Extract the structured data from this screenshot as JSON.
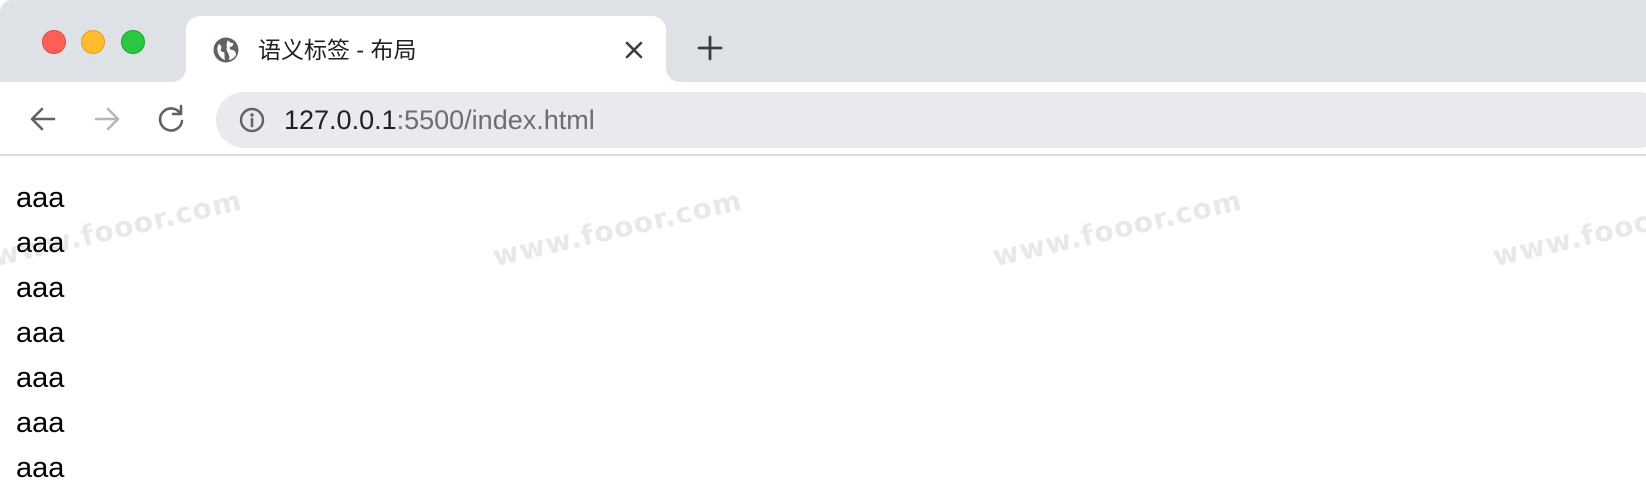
{
  "window": {
    "controls": [
      "close",
      "minimize",
      "maximize"
    ]
  },
  "tab": {
    "title": "语义标签 - 布局",
    "favicon": "globe-icon",
    "close_icon": "close-icon"
  },
  "new_tab_icon": "plus-icon",
  "toolbar": {
    "back_icon": "arrow-left-icon",
    "forward_icon": "arrow-right-icon",
    "reload_icon": "reload-icon",
    "info_icon": "info-icon",
    "url_host": "127.0.0.1",
    "url_rest": ":5500/index.html"
  },
  "content": {
    "lines": [
      "aaa",
      "aaa",
      "aaa",
      "aaa",
      "aaa",
      "aaa",
      "aaa"
    ]
  },
  "watermark": "www.fooor.com"
}
